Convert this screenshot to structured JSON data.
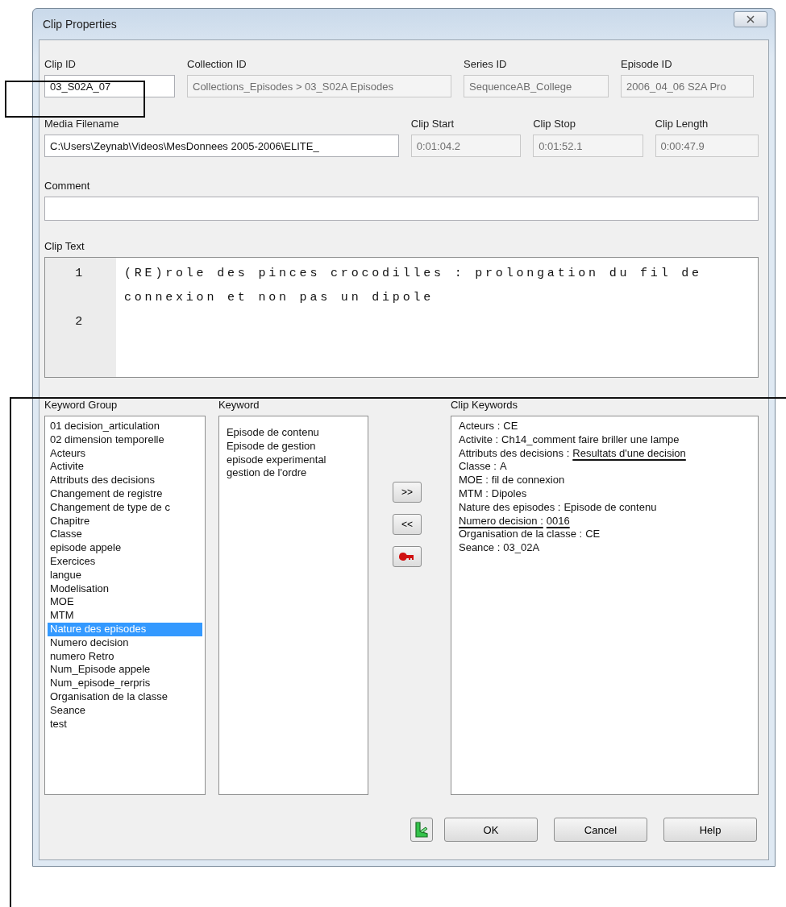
{
  "window": {
    "title": "Clip Properties"
  },
  "id_fields": [
    {
      "label": "Clip ID",
      "value": "03_S02A_07",
      "disabled": false
    },
    {
      "label": "Collection ID",
      "value": "Collections_Episodes > 03_S02A Episodes",
      "disabled": true
    },
    {
      "label": "Series ID",
      "value": "SequenceAB_College",
      "disabled": true
    },
    {
      "label": "Episode ID",
      "value": "2006_04_06 S2A Pro",
      "disabled": true
    }
  ],
  "media_fields": [
    {
      "label": "Media Filename",
      "value": "C:\\Users\\Zeynab\\Videos\\MesDonnees 2005-2006\\ELITE_",
      "disabled": false
    },
    {
      "label": "Clip Start",
      "value": "0:01:04.2",
      "disabled": true
    },
    {
      "label": "Clip Stop",
      "value": "0:01:52.1",
      "disabled": true
    },
    {
      "label": "Clip Length",
      "value": "0:00:47.9",
      "disabled": true
    }
  ],
  "comment": {
    "label": "Comment"
  },
  "clip_text": {
    "label": "Clip Text",
    "lines": [
      {
        "number": "1",
        "text": "(RE)role des pinces crocodilles : prolongation du fil de connexion et non pas un dipole"
      },
      {
        "number": "2"
      }
    ]
  },
  "keyword_group": {
    "label": "Keyword Group",
    "items": [
      {
        "text": "01 decision_articulation",
        "selected": false
      },
      {
        "text": "02 dimension temporelle",
        "selected": false
      },
      {
        "text": "Acteurs",
        "selected": false
      },
      {
        "text": "Activite",
        "selected": false
      },
      {
        "text": "Attributs des decisions",
        "selected": false
      },
      {
        "text": "Changement de registre",
        "selected": false
      },
      {
        "text": "Changement de type de c",
        "selected": false
      },
      {
        "text": "Chapitre",
        "selected": false
      },
      {
        "text": "Classe",
        "selected": false
      },
      {
        "text": "episode appele",
        "selected": false
      },
      {
        "text": "Exercices",
        "selected": false
      },
      {
        "text": "langue",
        "selected": false
      },
      {
        "text": "Modelisation",
        "selected": false
      },
      {
        "text": "MOE",
        "selected": false
      },
      {
        "text": "MTM",
        "selected": false
      },
      {
        "text": "Nature des episodes",
        "selected": true
      },
      {
        "text": "Numero decision",
        "selected": false
      },
      {
        "text": "numero Retro",
        "selected": false
      },
      {
        "text": "Num_Episode appele",
        "selected": false
      },
      {
        "text": "Num_episode_rerpris",
        "selected": false
      },
      {
        "text": "Organisation de la classe",
        "selected": false
      },
      {
        "text": "Seance",
        "selected": false
      },
      {
        "text": "test",
        "selected": false
      }
    ]
  },
  "keyword": {
    "label": "Keyword",
    "items": [
      {
        "text": "Episode de contenu",
        "selected": false
      },
      {
        "text": "Episode de gestion",
        "selected": false
      },
      {
        "text": "episode experimental",
        "selected": false
      },
      {
        "text": "gestion de l'ordre",
        "selected": false
      }
    ]
  },
  "move_buttons": [
    {
      "kind": "text",
      "label": ">>"
    },
    {
      "kind": "text",
      "label": "<<"
    },
    {
      "kind": "key"
    }
  ],
  "clip_keywords": {
    "label": "Clip Keywords",
    "items": [
      {
        "group": "Acteurs :",
        "value": "CE",
        "group_underlined": false,
        "value_underlined": false
      },
      {
        "group": "Activite :",
        "value": "Ch14_comment faire briller une lampe",
        "group_underlined": false,
        "value_underlined": false
      },
      {
        "group": "Attributs des decisions :",
        "value": "Resultats d'une decision",
        "group_underlined": false,
        "value_underlined": true
      },
      {
        "group": "Classe :",
        "value": "A",
        "group_underlined": false,
        "value_underlined": false
      },
      {
        "group": "MOE :",
        "value": "fil de connexion",
        "group_underlined": false,
        "value_underlined": false
      },
      {
        "group": "MTM :",
        "value": "Dipoles",
        "group_underlined": false,
        "value_underlined": false
      },
      {
        "group": "Nature des episodes :",
        "value": "Episode de contenu",
        "group_underlined": false,
        "value_underlined": false
      },
      {
        "group": "Numero decision :",
        "value": "0016",
        "group_underlined": true,
        "value_underlined": true
      },
      {
        "group": "Organisation de la classe :",
        "value": "CE",
        "group_underlined": false,
        "value_underlined": false
      },
      {
        "group": "Seance :",
        "value": "03_02A",
        "group_underlined": false,
        "value_underlined": false
      }
    ]
  },
  "buttons": [
    "OK",
    "Cancel",
    "Help"
  ]
}
